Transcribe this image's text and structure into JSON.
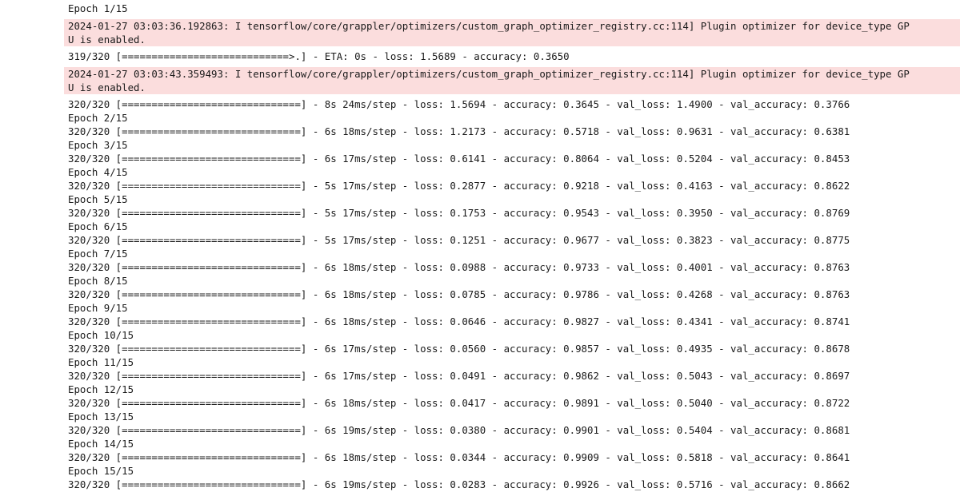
{
  "log": {
    "epoch_1": "Epoch 1/15",
    "warning_1": {
      "line_a": "2024-01-27 03:03:36.192863: I tensorflow/core/grappler/optimizers/custom_graph_optimizer_registry.cc:114] Plugin optimizer for device_type GP",
      "line_b": "U is enabled."
    },
    "progress_1": "319/320 [============================>.] - ETA: 0s - loss: 1.5689 - accuracy: 0.3650",
    "warning_2": {
      "line_a": "2024-01-27 03:03:43.359493: I tensorflow/core/grappler/optimizers/custom_graph_optimizer_registry.cc:114] Plugin optimizer for device_type GP",
      "line_b": "U is enabled."
    },
    "result_1": "320/320 [==============================] - 8s 24ms/step - loss: 1.5694 - accuracy: 0.3645 - val_loss: 1.4900 - val_accuracy: 0.3766",
    "epochs": [
      {
        "header": "Epoch 2/15",
        "result": "320/320 [==============================] - 6s 18ms/step - loss: 1.2173 - accuracy: 0.5718 - val_loss: 0.9631 - val_accuracy: 0.6381"
      },
      {
        "header": "Epoch 3/15",
        "result": "320/320 [==============================] - 6s 17ms/step - loss: 0.6141 - accuracy: 0.8064 - val_loss: 0.5204 - val_accuracy: 0.8453"
      },
      {
        "header": "Epoch 4/15",
        "result": "320/320 [==============================] - 5s 17ms/step - loss: 0.2877 - accuracy: 0.9218 - val_loss: 0.4163 - val_accuracy: 0.8622"
      },
      {
        "header": "Epoch 5/15",
        "result": "320/320 [==============================] - 5s 17ms/step - loss: 0.1753 - accuracy: 0.9543 - val_loss: 0.3950 - val_accuracy: 0.8769"
      },
      {
        "header": "Epoch 6/15",
        "result": "320/320 [==============================] - 5s 17ms/step - loss: 0.1251 - accuracy: 0.9677 - val_loss: 0.3823 - val_accuracy: 0.8775"
      },
      {
        "header": "Epoch 7/15",
        "result": "320/320 [==============================] - 6s 18ms/step - loss: 0.0988 - accuracy: 0.9733 - val_loss: 0.4001 - val_accuracy: 0.8763"
      },
      {
        "header": "Epoch 8/15",
        "result": "320/320 [==============================] - 6s 18ms/step - loss: 0.0785 - accuracy: 0.9786 - val_loss: 0.4268 - val_accuracy: 0.8763"
      },
      {
        "header": "Epoch 9/15",
        "result": "320/320 [==============================] - 6s 18ms/step - loss: 0.0646 - accuracy: 0.9827 - val_loss: 0.4341 - val_accuracy: 0.8741"
      },
      {
        "header": "Epoch 10/15",
        "result": "320/320 [==============================] - 6s 17ms/step - loss: 0.0560 - accuracy: 0.9857 - val_loss: 0.4935 - val_accuracy: 0.8678"
      },
      {
        "header": "Epoch 11/15",
        "result": "320/320 [==============================] - 6s 17ms/step - loss: 0.0491 - accuracy: 0.9862 - val_loss: 0.5043 - val_accuracy: 0.8697"
      },
      {
        "header": "Epoch 12/15",
        "result": "320/320 [==============================] - 6s 18ms/step - loss: 0.0417 - accuracy: 0.9891 - val_loss: 0.5040 - val_accuracy: 0.8722"
      },
      {
        "header": "Epoch 13/15",
        "result": "320/320 [==============================] - 6s 19ms/step - loss: 0.0380 - accuracy: 0.9901 - val_loss: 0.5404 - val_accuracy: 0.8681"
      },
      {
        "header": "Epoch 14/15",
        "result": "320/320 [==============================] - 6s 18ms/step - loss: 0.0344 - accuracy: 0.9909 - val_loss: 0.5818 - val_accuracy: 0.8641"
      },
      {
        "header": "Epoch 15/15",
        "result": "320/320 [==============================] - 6s 19ms/step - loss: 0.0283 - accuracy: 0.9926 - val_loss: 0.5716 - val_accuracy: 0.8662"
      }
    ]
  },
  "colors": {
    "warning_background": "#fbdddd",
    "text": "#1a1a1a",
    "page_background": "#ffffff"
  }
}
